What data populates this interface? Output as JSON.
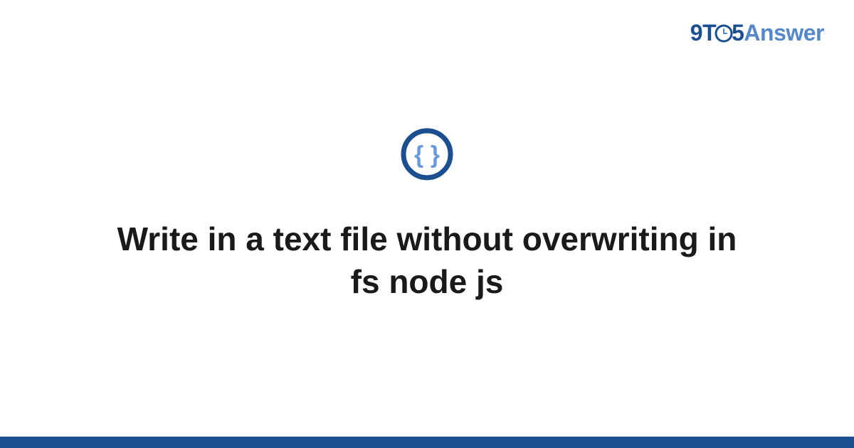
{
  "logo": {
    "part1": "9T",
    "part2": "5",
    "part3": "Answer"
  },
  "title": "Write in a text file without overwriting in fs node js",
  "icon_name": "code-braces-icon",
  "colors": {
    "primary": "#1b4f8f",
    "secondary": "#5488c7",
    "accent": "#6a9bd8"
  }
}
